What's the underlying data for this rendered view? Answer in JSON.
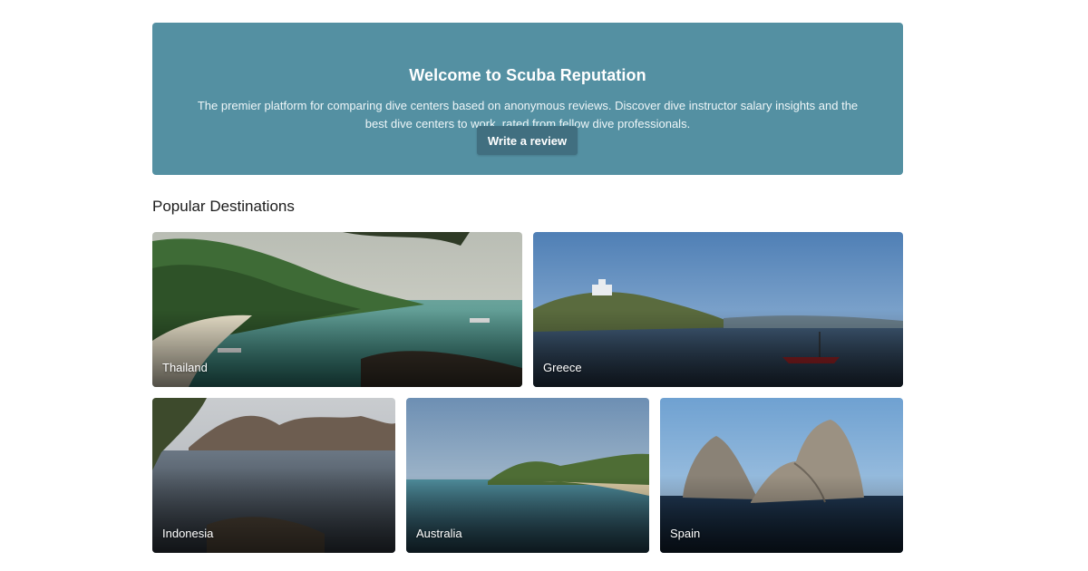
{
  "hero": {
    "title": "Welcome to Scuba Reputation",
    "description": "The premier platform for comparing dive centers based on anonymous reviews. Discover dive instructor salary insights and the best dive centers to work, rated from fellow dive professionals.",
    "button_label": "Write a review",
    "background_color": "#5490a2",
    "button_color": "#416f80"
  },
  "destinations": {
    "title": "Popular Destinations",
    "items": [
      {
        "label": "Thailand"
      },
      {
        "label": "Greece"
      },
      {
        "label": "Indonesia"
      },
      {
        "label": "Australia"
      },
      {
        "label": "Spain"
      }
    ]
  }
}
